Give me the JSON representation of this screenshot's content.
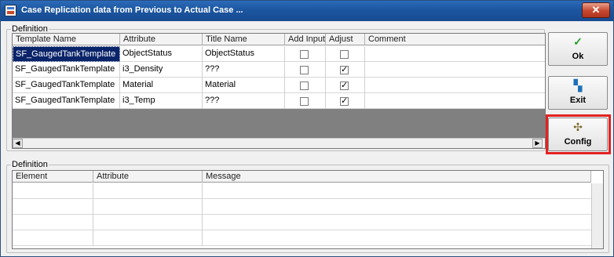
{
  "window": {
    "title": "Case Replication data from Previous to Actual Case ...",
    "close_label": "✕"
  },
  "definition_top": {
    "legend": "Definition",
    "columns": [
      "Template Name",
      "Attribute",
      "Title Name",
      "Add Input",
      "Adjust",
      "Comment"
    ],
    "rows": [
      {
        "template": "SF_GaugedTankTemplate",
        "attribute": "ObjectStatus",
        "title": "ObjectStatus",
        "add_input": false,
        "adjust": false,
        "comment": ""
      },
      {
        "template": "SF_GaugedTankTemplate",
        "attribute": "i3_Density",
        "title": "???",
        "add_input": false,
        "adjust": true,
        "comment": ""
      },
      {
        "template": "SF_GaugedTankTemplate",
        "attribute": "Material",
        "title": "Material",
        "add_input": false,
        "adjust": true,
        "comment": ""
      },
      {
        "template": "SF_GaugedTankTemplate",
        "attribute": "i3_Temp",
        "title": "???",
        "add_input": false,
        "adjust": true,
        "comment": ""
      }
    ],
    "scroll_left": "◀",
    "scroll_right": "▶"
  },
  "definition_bottom": {
    "legend": "Definition",
    "columns": [
      "Element",
      "Attribute",
      "Message"
    ]
  },
  "buttons": {
    "ok": {
      "label": "Ok",
      "icon": "checkmark-icon",
      "glyph": "✓"
    },
    "exit": {
      "label": "Exit",
      "icon": "exit-door-icon",
      "glyph": "▚"
    },
    "config": {
      "label": "Config",
      "icon": "gears-icon",
      "glyph": "✣"
    }
  },
  "colors": {
    "title_bar": "#1c56a0",
    "selection": "#0a246a",
    "highlight_frame": "#e32222"
  }
}
